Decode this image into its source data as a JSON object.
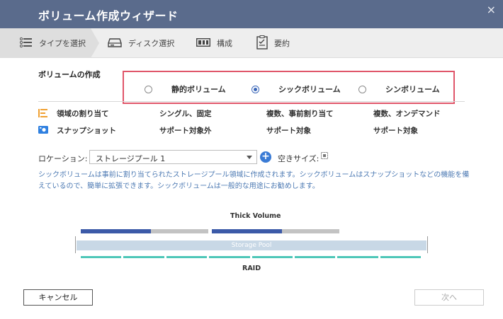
{
  "dialog": {
    "title": "ボリューム作成ウィザード",
    "close_glyph": "×"
  },
  "steps": [
    {
      "label": "タイプを選択",
      "icon": "list-icon",
      "active": true
    },
    {
      "label": "ディスク選択",
      "icon": "disk-icon",
      "active": false
    },
    {
      "label": "構成",
      "icon": "config-icon",
      "active": false
    },
    {
      "label": "要約",
      "icon": "clipboard-icon",
      "active": false
    }
  ],
  "volume_type": {
    "label": "ボリュームの作成",
    "options": [
      {
        "label": "静的ボリューム",
        "selected": false
      },
      {
        "label": "シックボリューム",
        "selected": true
      },
      {
        "label": "シンボリューム",
        "selected": false
      }
    ]
  },
  "features": [
    {
      "icon": "allocation-icon",
      "label": "領域の割り当て",
      "values": [
        "シングル、固定",
        "複数、事前割り当て",
        "複数、オンデマンド"
      ]
    },
    {
      "icon": "snapshot-icon",
      "label": "スナップショット",
      "values": [
        "サポート対象外",
        "サポート対象",
        "サポート対象"
      ]
    }
  ],
  "location": {
    "label": "ロケーション:",
    "selected": "ストレージプール 1",
    "free_size_label": "空きサイズ:"
  },
  "description": "シックボリュームは事前に割り当てられたストレージプール領域に作成されます。シックボリュームはスナップショットなどの機能を備えているので、簡単に拡張できます。シックボリュームは一般的な用途にお勧めします。",
  "diagram": {
    "title": "Thick Volume",
    "pool_label": "Storage Pool",
    "raid_label": "RAID",
    "volume_fill_fractions": [
      0.55,
      0.55
    ],
    "raid_disk_count": 8
  },
  "buttons": {
    "cancel": "キャンセル",
    "next": "次へ"
  },
  "colors": {
    "title_bar": "#5a6b8c",
    "highlight_border": "#e0566a",
    "accent_blue": "#3c5aa8",
    "raid_teal": "#4ec7b8",
    "description_text": "#4d7ab3"
  }
}
